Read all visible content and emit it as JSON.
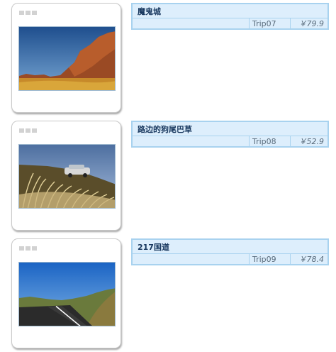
{
  "products": [
    {
      "title": "魔鬼城",
      "code": "Trip07",
      "price": "￥79.9",
      "image": "red-rock-canyon-photo"
    },
    {
      "title": "路边的狗尾巴草",
      "code": "Trip08",
      "price": "￥52.9",
      "image": "grass-and-car-photo"
    },
    {
      "title": "217国道",
      "code": "Trip09",
      "price": "￥78.4",
      "image": "highway-photo"
    }
  ],
  "colors": {
    "panel_bg": "#ddeefc",
    "panel_border": "#a8d2ef",
    "title_text": "#17375e",
    "meta_text": "#5a6c7c"
  }
}
